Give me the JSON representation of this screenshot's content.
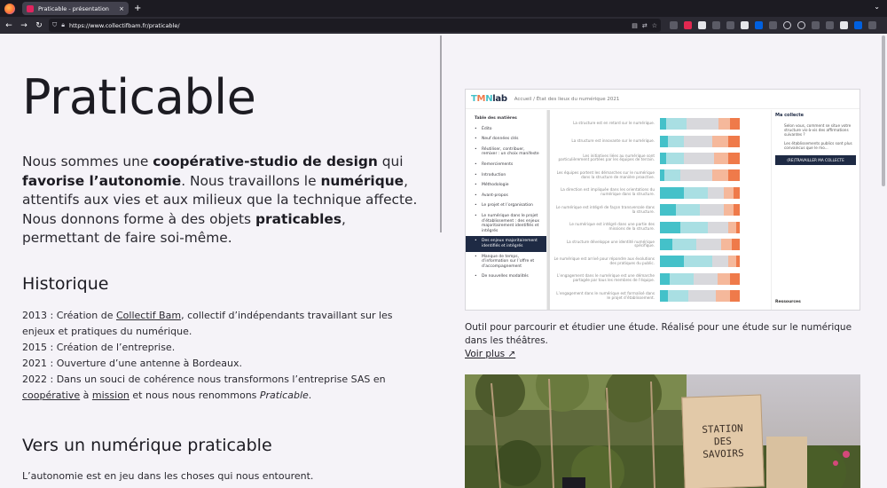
{
  "browser": {
    "tab_title": "Praticable - présentation",
    "tab_close": "×",
    "new_tab": "+",
    "url": "https://www.collectifbam.fr/praticable/",
    "back": "←",
    "forward": "→",
    "reload": "↻"
  },
  "main": {
    "title": "Praticable",
    "intro": {
      "p1": "Nous sommes une ",
      "b1": "coopérative-studio de design",
      "p2": " qui ",
      "b2": "favorise l’autonomie",
      "p3": ". Nous travaillons le ",
      "b3": "numérique",
      "p4": ", attentifs aux vies et aux milieux que la technique affecte. Nous donnons forme à des objets ",
      "b4": "praticables",
      "p5": ", permettant de faire soi-même."
    },
    "historique": {
      "heading": "Historique",
      "l1_pre": "2013 : Création de ",
      "l1_link": "Collectif Bam",
      "l1_post": ", collectif d’indépendants travaillant sur les enjeux et pratiques du numérique.",
      "l2": "2015 : Création de l’entreprise.",
      "l3": "2021 : Ouverture d’une antenne à Bordeaux.",
      "l4_pre": "2022 : Dans un souci de cohérence nous transformons l’entreprise SAS en ",
      "l4_link1": "coopérative",
      "l4_mid": " à ",
      "l4_link2": "mission",
      "l4_post": " et nous nous renommons ",
      "l4_em": "Praticable",
      "l4_end": "."
    },
    "numerique": {
      "heading": "Vers un numérique praticable",
      "text": "L’autonomie est en jeu dans les choses qui nous entourent."
    }
  },
  "project": {
    "app_logo": {
      "a": "T",
      "b": "M",
      "c": "N",
      "d": "lab"
    },
    "breadcrumb": "Accueil  /  État des lieux du numérique 2021",
    "toc_title": "Table des matières",
    "toc": [
      {
        "label": "Édito",
        "active": false
      },
      {
        "label": "Neuf données clés",
        "active": false
      },
      {
        "label": "Réutiliser, contribuer, remixer : un choix manifeste",
        "active": false
      },
      {
        "label": "Remerciements",
        "active": false
      },
      {
        "label": "Introduction",
        "active": false
      },
      {
        "label": "Méthodologie",
        "active": false
      },
      {
        "label": "Avant-propos",
        "active": false
      },
      {
        "label": "Le projet et l’organisation",
        "active": false
      },
      {
        "label": "Le numérique dans le projet d’établissement : des enjeux majoritairement identifiés et intégrés",
        "active": false
      },
      {
        "label": "Des enjeux majoritairement identifiés et intégrés",
        "active": true
      },
      {
        "label": "Manque de temps, d’information sur l’offre et d’accompagnement",
        "active": false
      },
      {
        "label": "De nouvelles modalités",
        "active": false
      }
    ],
    "rows": [
      {
        "label": "La structure est en retard sur le numérique.",
        "v": [
          0.08,
          0.25,
          0.4,
          0.15,
          0.12
        ]
      },
      {
        "label": "La structure est innovante sur le numérique.",
        "v": [
          0.1,
          0.2,
          0.35,
          0.2,
          0.15
        ]
      },
      {
        "label": "Les initiatives liées au numérique sont particulièrement portées par les équipes de terrain.",
        "v": [
          0.08,
          0.22,
          0.38,
          0.18,
          0.14
        ]
      },
      {
        "label": "Les équipes portent les démarches sur le numérique dans la structure de manière proactive.",
        "v": [
          0.06,
          0.2,
          0.4,
          0.2,
          0.14
        ]
      },
      {
        "label": "La direction est impliquée dans les orientations du numérique dans la structure.",
        "v": [
          0.3,
          0.3,
          0.2,
          0.12,
          0.08
        ]
      },
      {
        "label": "Le numérique est intégré de façon transversale dans la structure.",
        "v": [
          0.2,
          0.3,
          0.3,
          0.12,
          0.08
        ]
      },
      {
        "label": "Le numérique est intégré dans une partie des missions de la structure.",
        "v": [
          0.25,
          0.35,
          0.25,
          0.1,
          0.05
        ]
      },
      {
        "label": "La structure développe une identité numérique spécifique.",
        "v": [
          0.15,
          0.3,
          0.32,
          0.13,
          0.1
        ]
      },
      {
        "label": "Le numérique est arrivé pour répondre aux évolutions des pratiques du public.",
        "v": [
          0.3,
          0.35,
          0.2,
          0.1,
          0.05
        ]
      },
      {
        "label": "L’engagement dans le numérique est une démarche partagée par tous les membres de l’équipe.",
        "v": [
          0.12,
          0.3,
          0.3,
          0.16,
          0.12
        ]
      },
      {
        "label": "L’engagement dans le numérique est formalisé dans le projet d’établissement.",
        "v": [
          0.1,
          0.25,
          0.35,
          0.18,
          0.12
        ]
      }
    ],
    "side": {
      "title": "Ma collecte",
      "item1": "Selon vous, comment se situe votre structure vis-à-vis des affirmations suivantes ?",
      "item2": "Les établissements publics sont plus convaincus que le mo...",
      "button": "(RE)TRAVAILLER MA COLLECTE",
      "footer": "Ressources"
    },
    "caption": "Outil pour parcourir et étudier une étude. Réalisé pour une étude sur le numérique dans les théâtres.",
    "more_link": "Voir plus ↗"
  },
  "photo": {
    "sign_l1": "STATION",
    "sign_l2": "DES",
    "sign_l3": "SAVOIRS"
  },
  "colors": {
    "accent_teal": "#44c1c9",
    "accent_orange": "#ef7a4a",
    "navy": "#1e2a44"
  }
}
